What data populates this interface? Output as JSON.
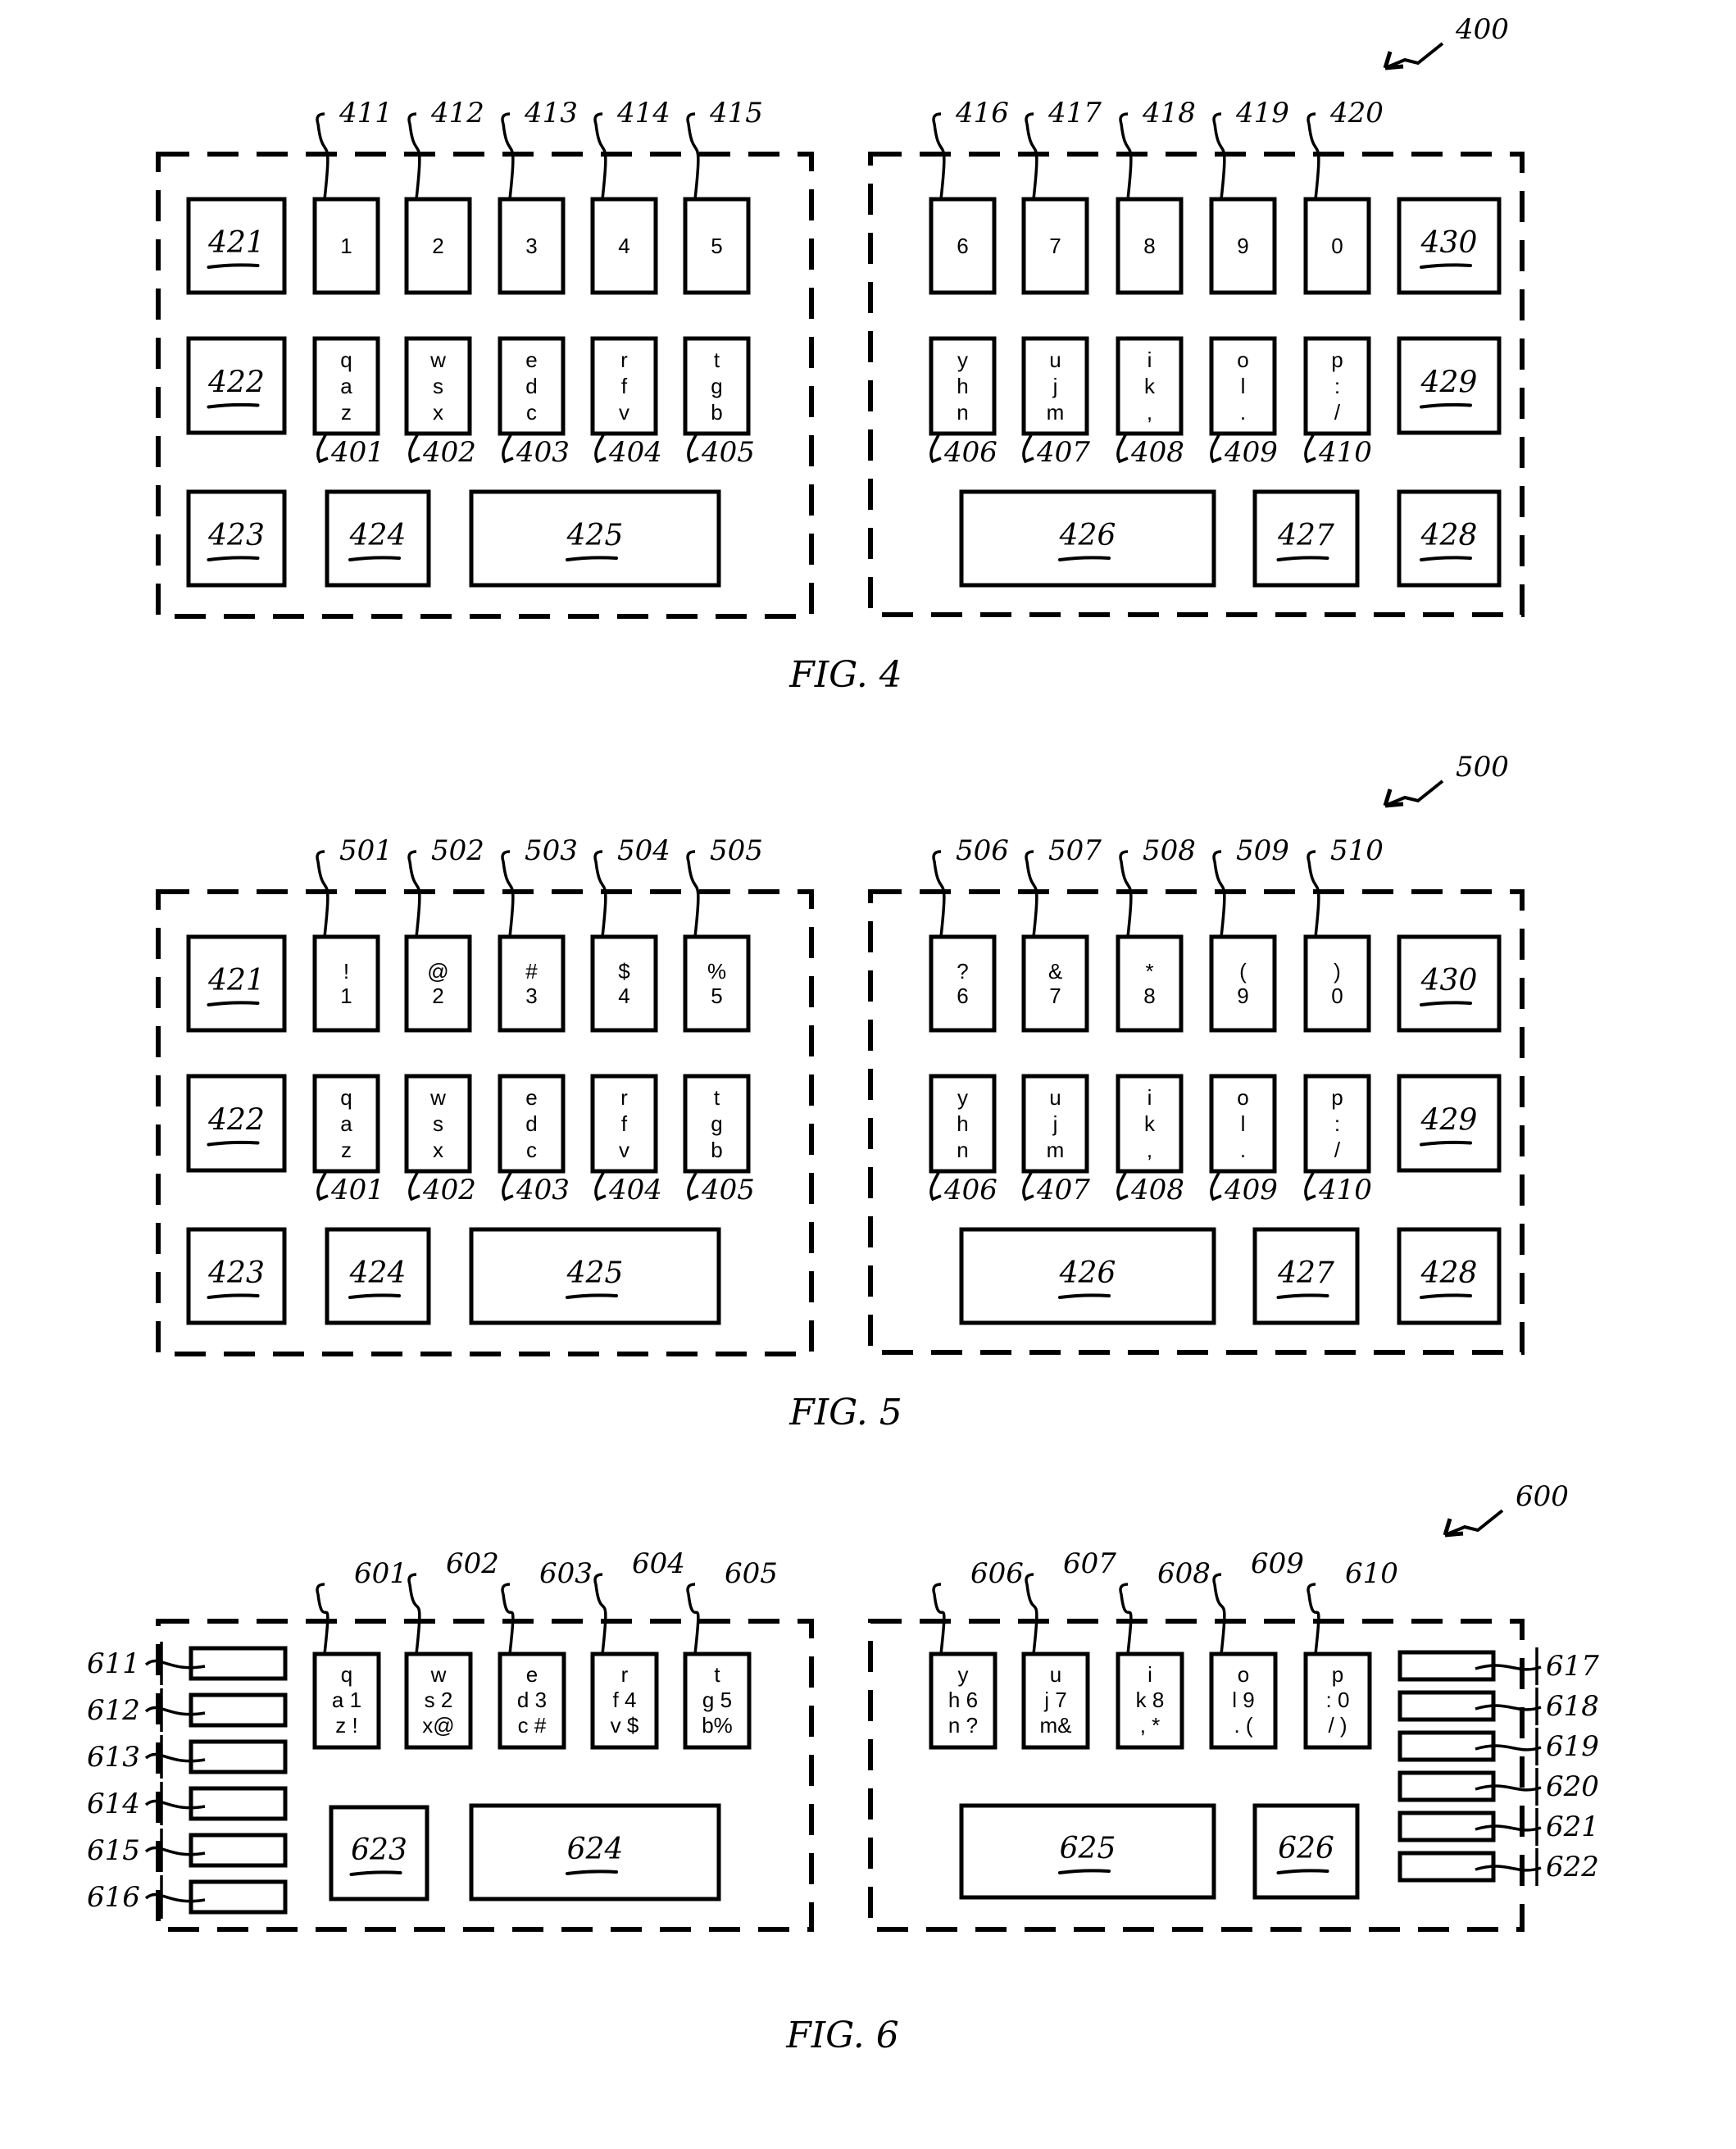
{
  "page": {
    "colors": {
      "ink": "#000000",
      "paper": "#ffffff"
    }
  },
  "figures": [
    {
      "id": "fig4",
      "caption": "FIG. 4",
      "ref": "400",
      "left": {
        "top_row_refs": [
          "411",
          "412",
          "413",
          "414",
          "415"
        ],
        "top_row_keys": [
          [
            "1"
          ],
          [
            "2"
          ],
          [
            "3"
          ],
          [
            "4"
          ],
          [
            "5"
          ]
        ],
        "mid_row_refs": [
          "401",
          "402",
          "403",
          "404",
          "405"
        ],
        "mid_row_keys": [
          [
            "q",
            "a",
            "z"
          ],
          [
            "w",
            "s",
            "x"
          ],
          [
            "e",
            "d",
            "c"
          ],
          [
            "r",
            "f",
            "v"
          ],
          [
            "t",
            "g",
            "b"
          ]
        ],
        "func_keys": [
          "421",
          "422",
          "423",
          "424",
          "425"
        ]
      },
      "right": {
        "top_row_refs": [
          "416",
          "417",
          "418",
          "419",
          "420"
        ],
        "top_row_keys": [
          [
            "6"
          ],
          [
            "7"
          ],
          [
            "8"
          ],
          [
            "9"
          ],
          [
            "0"
          ]
        ],
        "mid_row_refs": [
          "406",
          "407",
          "408",
          "409",
          "410"
        ],
        "mid_row_keys": [
          [
            "y",
            "h",
            "n"
          ],
          [
            "u",
            "j",
            "m"
          ],
          [
            "i",
            "k",
            ","
          ],
          [
            "o",
            "l",
            "."
          ],
          [
            "p",
            ":",
            "/"
          ]
        ],
        "func_keys": [
          "430",
          "429",
          "426",
          "427",
          "428"
        ]
      }
    },
    {
      "id": "fig5",
      "caption": "FIG. 5",
      "ref": "500",
      "left": {
        "top_row_refs": [
          "501",
          "502",
          "503",
          "504",
          "505"
        ],
        "top_row_keys": [
          [
            "!",
            "1"
          ],
          [
            "@",
            "2"
          ],
          [
            "#",
            "3"
          ],
          [
            "$",
            "4"
          ],
          [
            "%",
            "5"
          ]
        ],
        "mid_row_refs": [
          "401",
          "402",
          "403",
          "404",
          "405"
        ],
        "mid_row_keys": [
          [
            "q",
            "a",
            "z"
          ],
          [
            "w",
            "s",
            "x"
          ],
          [
            "e",
            "d",
            "c"
          ],
          [
            "r",
            "f",
            "v"
          ],
          [
            "t",
            "g",
            "b"
          ]
        ],
        "func_keys": [
          "421",
          "422",
          "423",
          "424",
          "425"
        ]
      },
      "right": {
        "top_row_refs": [
          "506",
          "507",
          "508",
          "509",
          "510"
        ],
        "top_row_keys": [
          [
            "?",
            "6"
          ],
          [
            "&",
            "7"
          ],
          [
            "*",
            "8"
          ],
          [
            "(",
            "9"
          ],
          [
            ")",
            "0"
          ]
        ],
        "mid_row_refs": [
          "406",
          "407",
          "408",
          "409",
          "410"
        ],
        "mid_row_keys": [
          [
            "y",
            "h",
            "n"
          ],
          [
            "u",
            "j",
            "m"
          ],
          [
            "i",
            "k",
            ","
          ],
          [
            "o",
            "l",
            "."
          ],
          [
            "p",
            ":",
            "/"
          ]
        ],
        "func_keys": [
          "430",
          "429",
          "426",
          "427",
          "428"
        ]
      }
    },
    {
      "id": "fig6",
      "caption": "FIG. 6",
      "ref": "600",
      "left": {
        "top_row_refs": [
          "601",
          "602",
          "603",
          "604",
          "605"
        ],
        "keys": [
          [
            "q",
            "a 1",
            "z !"
          ],
          [
            "w",
            "s 2",
            "x@"
          ],
          [
            "e",
            "d 3",
            "c #"
          ],
          [
            "r",
            "f 4",
            "v $"
          ],
          [
            "t",
            "g 5",
            "b%"
          ]
        ],
        "side_refs": [
          "611",
          "612",
          "613",
          "614",
          "615",
          "616"
        ],
        "func_keys": [
          "623",
          "624"
        ]
      },
      "right": {
        "top_row_refs": [
          "606",
          "607",
          "608",
          "609",
          "610"
        ],
        "keys": [
          [
            "y",
            "h 6",
            "n ?"
          ],
          [
            "u",
            "j 7",
            "m&"
          ],
          [
            "i",
            "k 8",
            ",  *"
          ],
          [
            "o",
            "l 9",
            ".  ("
          ],
          [
            "p",
            ": 0",
            "/ )"
          ]
        ],
        "side_refs": [
          "617",
          "618",
          "619",
          "620",
          "621",
          "622"
        ],
        "func_keys": [
          "625",
          "626"
        ]
      }
    }
  ]
}
